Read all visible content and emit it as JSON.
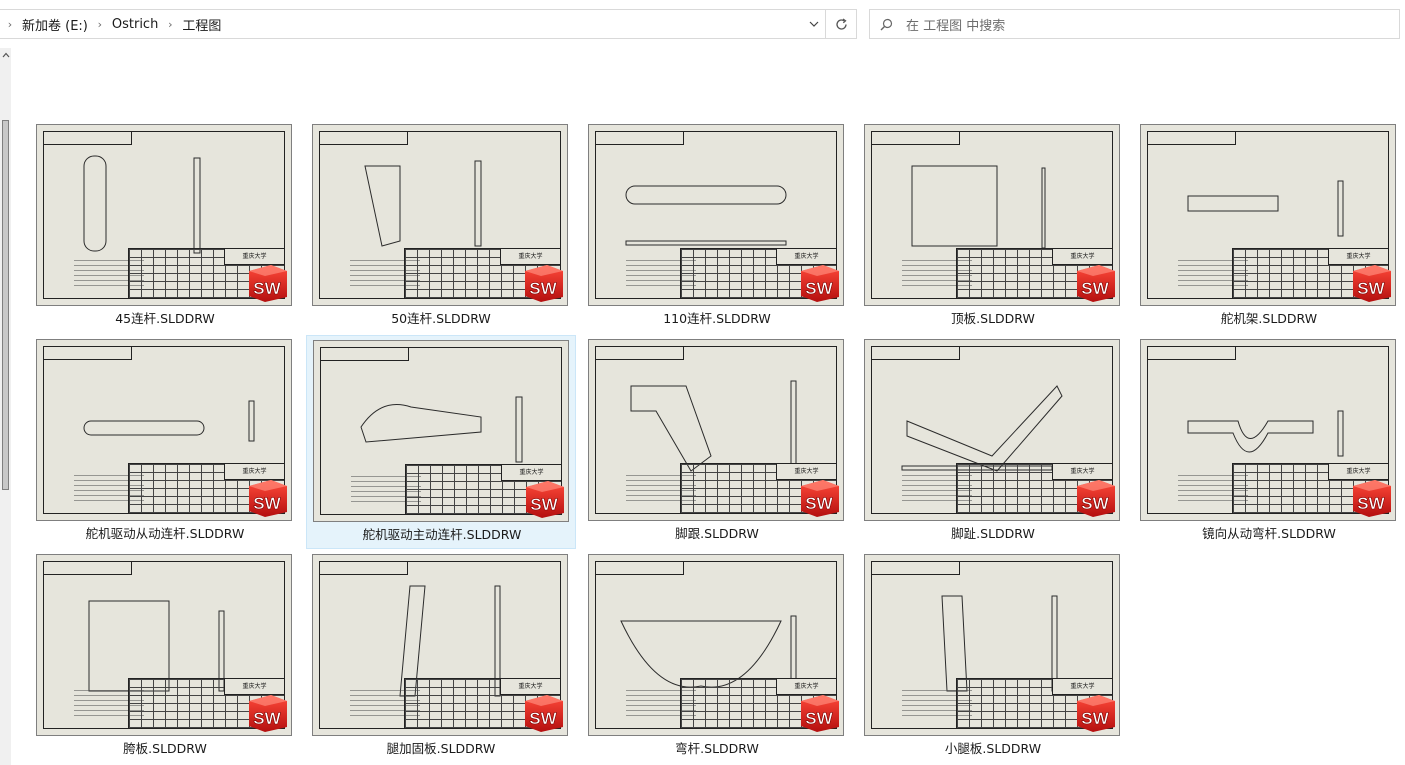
{
  "address_bar": {
    "crumbs": [
      "新加卷 (E:)",
      "Ostrich",
      "工程图"
    ],
    "dropdown_icon": "chevron-down-icon",
    "refresh_icon": "refresh-icon"
  },
  "search": {
    "placeholder": "在 工程图 中搜索",
    "icon": "search-icon"
  },
  "files": [
    {
      "name": "45连杆.SLDDRW",
      "selected": false
    },
    {
      "name": "50连杆.SLDDRW",
      "selected": false
    },
    {
      "name": "110连杆.SLDDRW",
      "selected": false
    },
    {
      "name": "顶板.SLDDRW",
      "selected": false
    },
    {
      "name": "舵机架.SLDDRW",
      "selected": false
    },
    {
      "name": "舵机驱动从动连杆.SLDDRW",
      "selected": false
    },
    {
      "name": "舵机驱动主动连杆.SLDDRW",
      "selected": true
    },
    {
      "name": "脚跟.SLDDRW",
      "selected": false
    },
    {
      "name": "脚趾.SLDDRW",
      "selected": false
    },
    {
      "name": "镜向从动弯杆.SLDDRW",
      "selected": false
    },
    {
      "name": "胯板.SLDDRW",
      "selected": false
    },
    {
      "name": "腿加固板.SLDDRW",
      "selected": false
    },
    {
      "name": "弯杆.SLDDRW",
      "selected": false
    },
    {
      "name": "小腿板.SLDDRW",
      "selected": false
    }
  ],
  "thumbnail": {
    "title_block_text": "重庆大学",
    "logo_text": "SW",
    "logo_colors": {
      "top": "#ff4a3a",
      "bottom": "#b40f0f"
    }
  }
}
